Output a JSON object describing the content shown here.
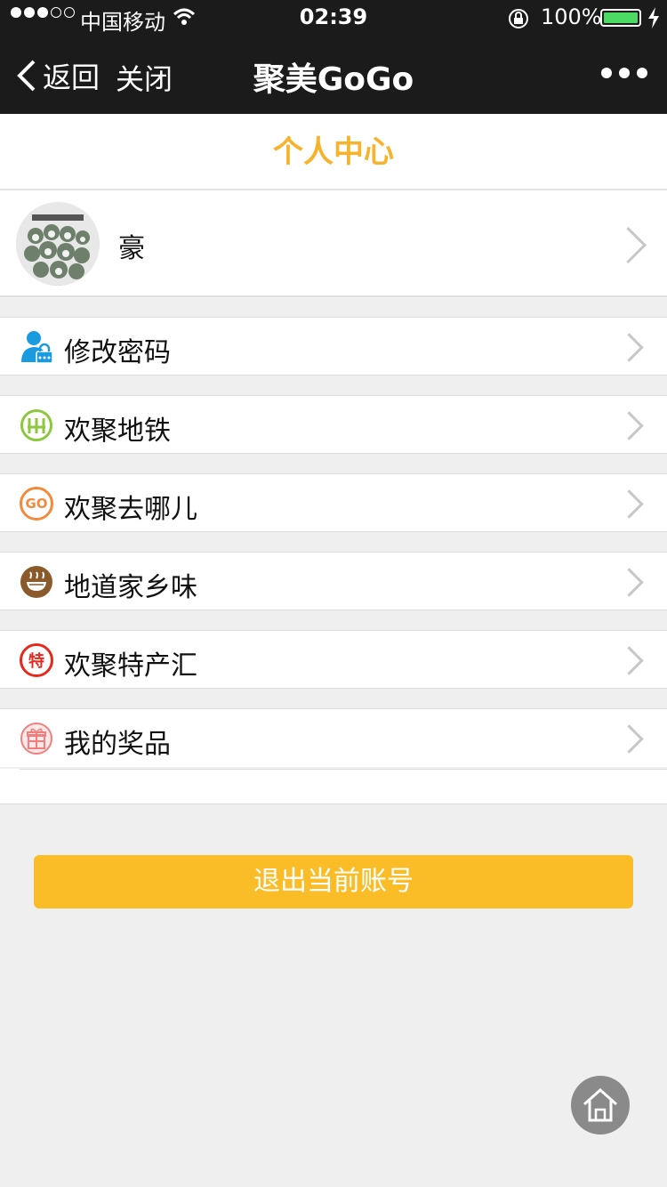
{
  "status": {
    "carrier": "中国移动",
    "time": "02:39",
    "battery": "100%"
  },
  "nav": {
    "back": "返回",
    "close": "关闭",
    "title": "聚美GoGo"
  },
  "page": {
    "title": "个人中心"
  },
  "profile": {
    "name": "豪"
  },
  "menu": [
    {
      "label": "修改密码",
      "icon": "user-lock-icon"
    },
    {
      "label": "欢聚地铁",
      "icon": "subway-icon"
    },
    {
      "label": "欢聚去哪儿",
      "icon": "go-icon"
    },
    {
      "label": "地道家乡味",
      "icon": "noodle-bowl-icon"
    },
    {
      "label": "欢聚特产汇",
      "icon": "specialty-icon"
    },
    {
      "label": "我的奖品",
      "icon": "gift-icon"
    }
  ],
  "icons_text": {
    "go": "GO",
    "te": "特"
  },
  "logout": {
    "label": "退出当前账号"
  },
  "colors": {
    "accent": "#fbbd27",
    "title_accent": "#f7b32b",
    "nav_bg": "#1b1b1b",
    "battery": "#4cd964"
  }
}
